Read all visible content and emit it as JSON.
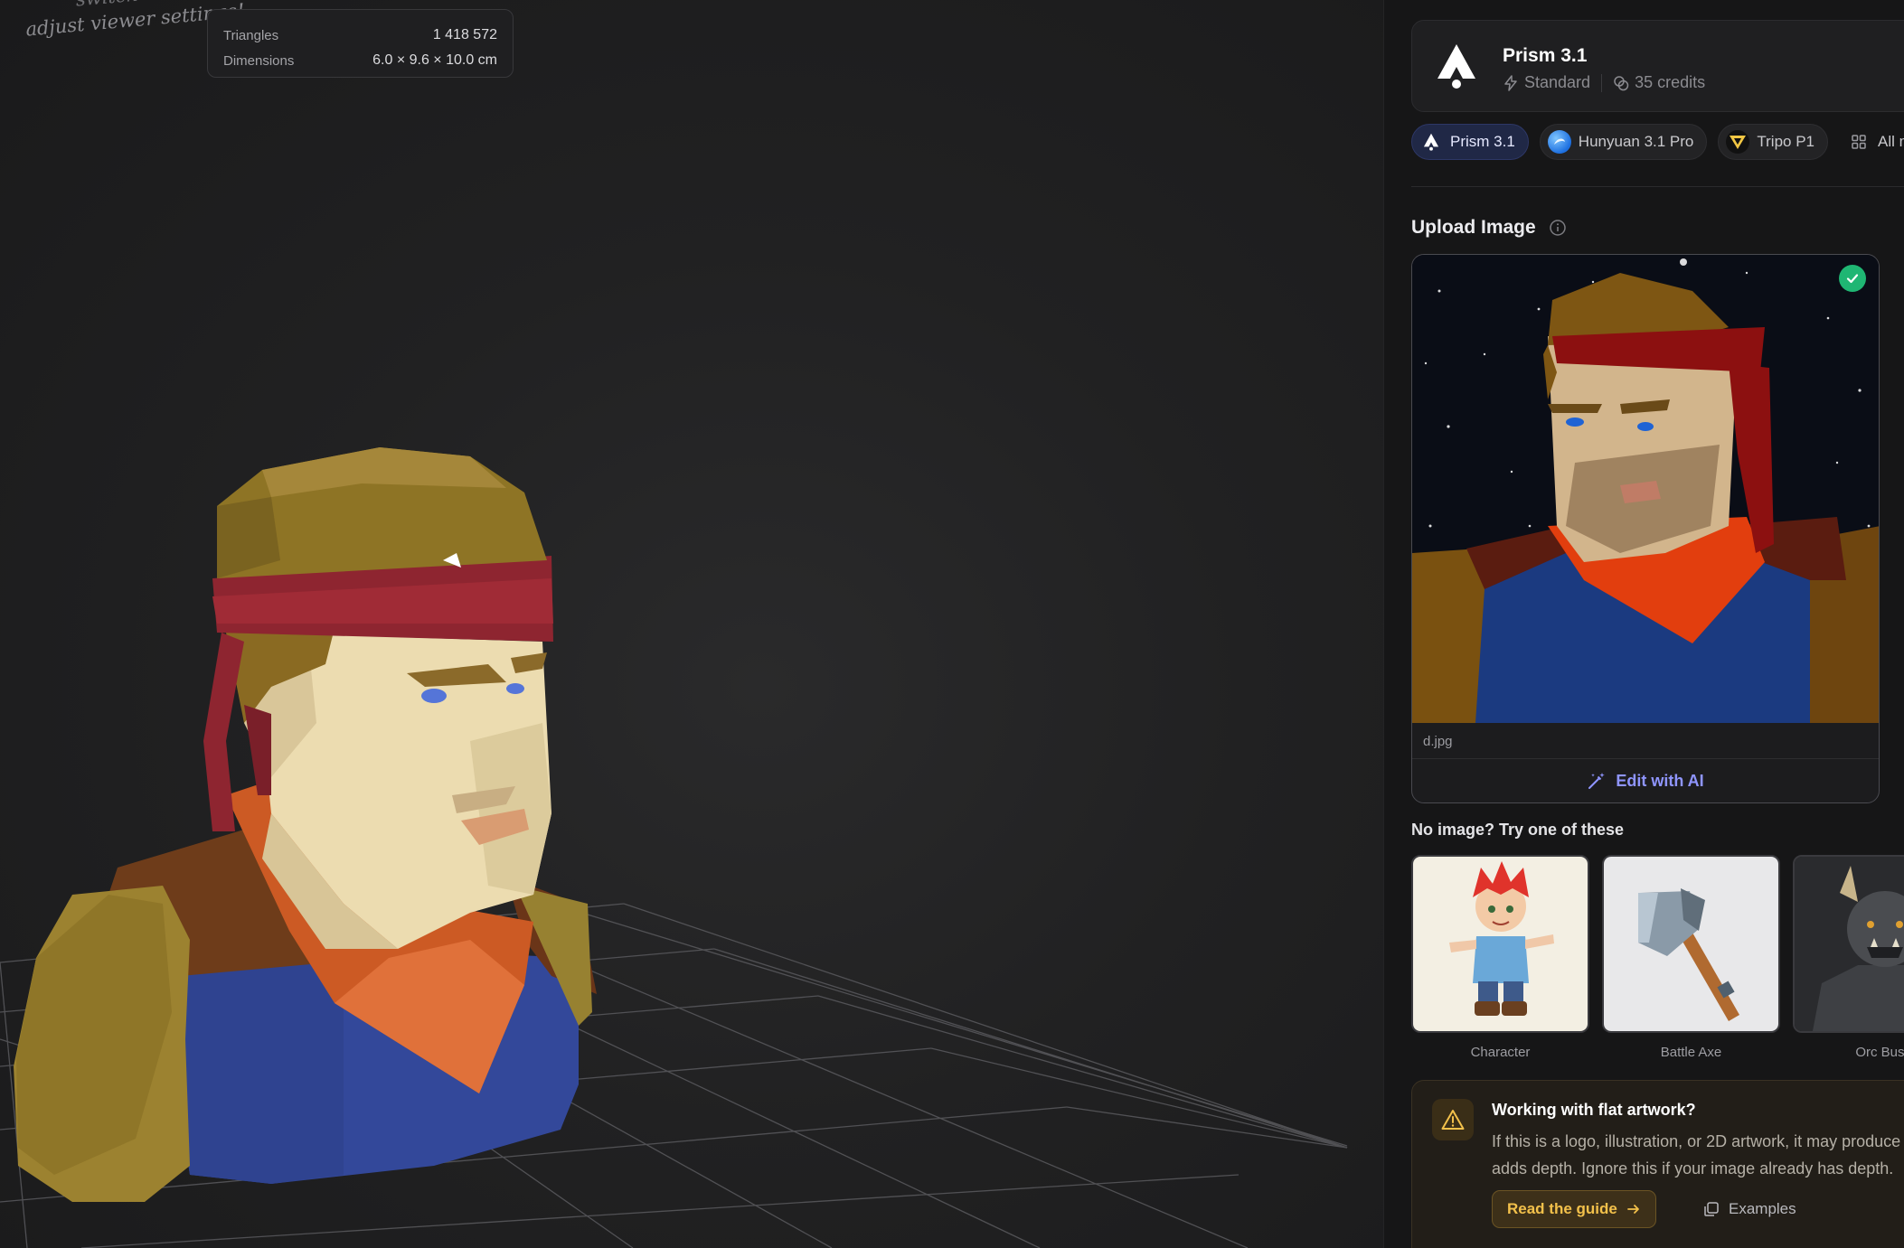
{
  "viewer": {
    "hint_line1": "switch views or",
    "hint_line2": "adjust viewer settings!",
    "stats": [
      {
        "label": "Triangles",
        "value": "1 418 572"
      },
      {
        "label": "Dimensions",
        "value": "6.0 × 9.6 × 10.0 cm"
      }
    ]
  },
  "model": {
    "name": "Prism 3.1",
    "tier": "Standard",
    "credits": "35 credits"
  },
  "model_chips": [
    {
      "label": "Prism 3.1",
      "icon": "prism-logo-icon",
      "active": true
    },
    {
      "label": "Hunyuan 3.1 Pro",
      "icon": "hunyuan-logo-icon",
      "active": false
    },
    {
      "label": "Tripo P1",
      "icon": "tripo-logo-icon",
      "active": false
    },
    {
      "label": "All models",
      "icon": "grid-icon",
      "active": false
    }
  ],
  "upload": {
    "title": "Upload Image",
    "file_name": "d.jpg",
    "edit_label": "Edit with AI"
  },
  "examples": {
    "title": "No image? Try one of these",
    "items": [
      "Character",
      "Battle Axe",
      "Orc Bust"
    ]
  },
  "warning": {
    "title": "Working with flat artwork?",
    "line1": "If this is a logo, illustration, or 2D artwork, it may produce",
    "line2": "adds depth. Ignore this if your image already has depth.",
    "guide_label": "Read the guide",
    "examples_label": "Examples"
  },
  "colors": {
    "accent": "#8f95ff",
    "success": "#1fb673",
    "warning": "#f3c14b"
  }
}
